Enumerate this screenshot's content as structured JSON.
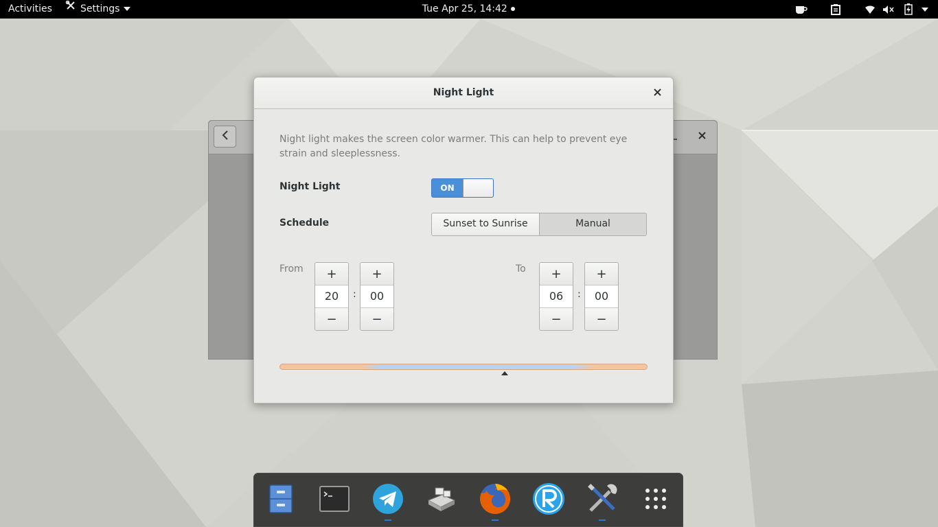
{
  "topbar": {
    "activities": "Activities",
    "app_menu": "Settings",
    "clock": "Tue Apr 25, 14:42",
    "tray_icons": [
      "coffee-icon",
      "clipboard-icon",
      "wifi-icon",
      "volume-muted-icon",
      "battery-charging-icon",
      "system-menu-arrow-icon"
    ]
  },
  "background_window": {
    "icons": [
      "back-arrow-icon",
      "minimize-icon",
      "close-icon"
    ]
  },
  "dialog": {
    "title": "Night Light",
    "description": "Night light makes the screen color warmer. This can help to prevent eye strain and sleeplessness.",
    "night_light_label": "Night Light",
    "switch_state": "ON",
    "schedule_label": "Schedule",
    "schedule_options": [
      "Sunset to Sunrise",
      "Manual"
    ],
    "schedule_selected": "Manual",
    "from_label": "From",
    "to_label": "To",
    "from_hour": "20",
    "from_minute": "00",
    "to_hour": "06",
    "to_minute": "00",
    "time_separator": ":",
    "plus": "+",
    "minus": "−",
    "bar_colors": {
      "warm": "#f8c49c",
      "cool": "#b9d3ee"
    }
  },
  "dock": {
    "items": [
      {
        "name": "files",
        "running": false
      },
      {
        "name": "terminal",
        "running": false
      },
      {
        "name": "telegram",
        "running": true
      },
      {
        "name": "keyboard-settings",
        "running": false
      },
      {
        "name": "firefox",
        "running": true
      },
      {
        "name": "r-app",
        "running": false
      },
      {
        "name": "settings",
        "running": true
      },
      {
        "name": "show-applications",
        "running": false
      }
    ]
  },
  "colors": {
    "accent": "#4a90d9",
    "topbar": "#000000",
    "dock": "#282828"
  }
}
